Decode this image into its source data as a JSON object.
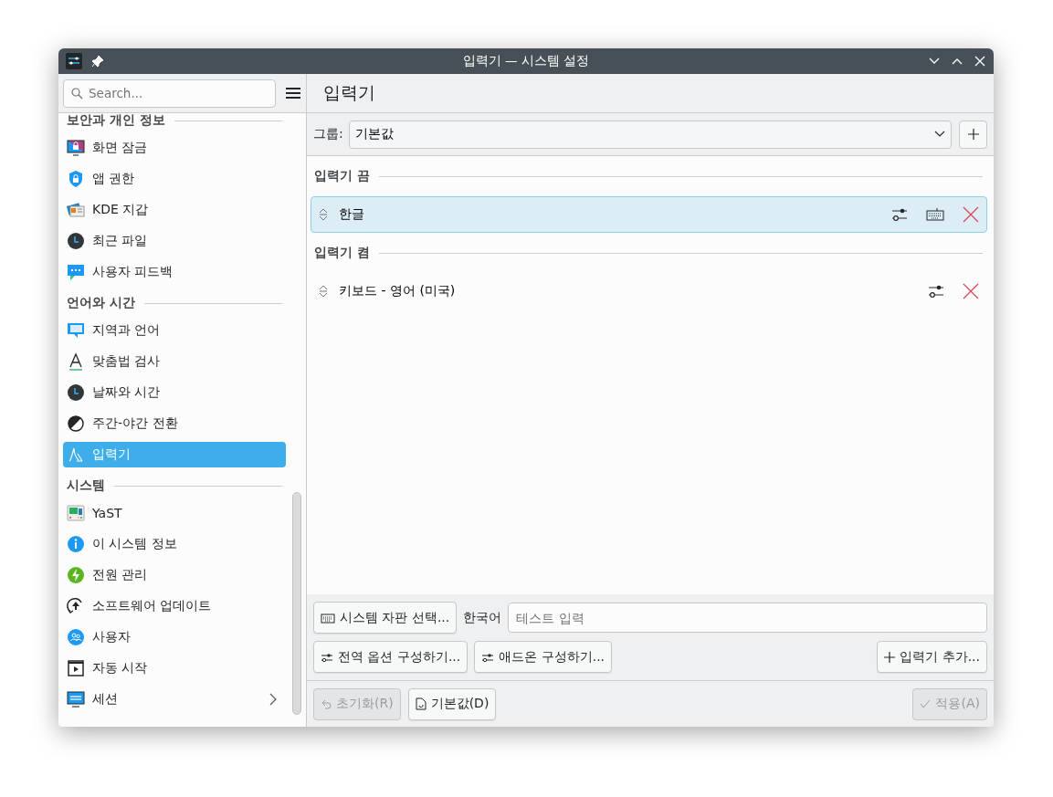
{
  "window": {
    "title": "입력기 — 시스템 설정"
  },
  "search": {
    "placeholder": "Search..."
  },
  "page_title": "입력기",
  "sidebar": {
    "sections": [
      {
        "title": "보안과 개인 정보",
        "items": [
          {
            "label": "화면 잠금",
            "selected": false,
            "has_children": false
          },
          {
            "label": "앱 권한",
            "selected": false,
            "has_children": false
          },
          {
            "label": "KDE 지갑",
            "selected": false,
            "has_children": false
          },
          {
            "label": "최근 파일",
            "selected": false,
            "has_children": false
          },
          {
            "label": "사용자 피드백",
            "selected": false,
            "has_children": false
          }
        ]
      },
      {
        "title": "언어와 시간",
        "items": [
          {
            "label": "지역과 언어",
            "selected": false,
            "has_children": false
          },
          {
            "label": "맞춤법 검사",
            "selected": false,
            "has_children": false
          },
          {
            "label": "날짜와 시간",
            "selected": false,
            "has_children": false
          },
          {
            "label": "주간-야간 전환",
            "selected": false,
            "has_children": false
          },
          {
            "label": "입력기",
            "selected": true,
            "has_children": false
          }
        ]
      },
      {
        "title": "시스템",
        "items": [
          {
            "label": "YaST",
            "selected": false,
            "has_children": false
          },
          {
            "label": "이 시스템 정보",
            "selected": false,
            "has_children": false
          },
          {
            "label": "전원 관리",
            "selected": false,
            "has_children": false
          },
          {
            "label": "소프트웨어 업데이트",
            "selected": false,
            "has_children": false
          },
          {
            "label": "사용자",
            "selected": false,
            "has_children": false
          },
          {
            "label": "자동 시작",
            "selected": false,
            "has_children": false
          },
          {
            "label": "세션",
            "selected": false,
            "has_children": true
          }
        ]
      }
    ]
  },
  "group": {
    "label": "그룹:",
    "value": "기본값"
  },
  "input_groups": [
    {
      "title": "입력기 끔",
      "items": [
        {
          "label": "한글",
          "selected": true,
          "layout_button": true
        }
      ]
    },
    {
      "title": "입력기 켬",
      "items": [
        {
          "label": "키보드 - 영어 (미국)",
          "selected": false,
          "layout_button": false
        }
      ]
    }
  ],
  "layout_button": "시스템 자판 선택...",
  "test_language": "한국어",
  "test_field": {
    "placeholder": "테스트 입력"
  },
  "config_buttons": [
    "전역 옵션 구성하기...",
    "애드온 구성하기..."
  ],
  "add_button": "입력기 추가...",
  "footer": {
    "reset": {
      "label": "초기화(R)",
      "disabled": true
    },
    "defaults": {
      "label": "기본값(D)",
      "disabled": false
    },
    "apply": {
      "label": "적용(A)",
      "disabled": true
    }
  }
}
